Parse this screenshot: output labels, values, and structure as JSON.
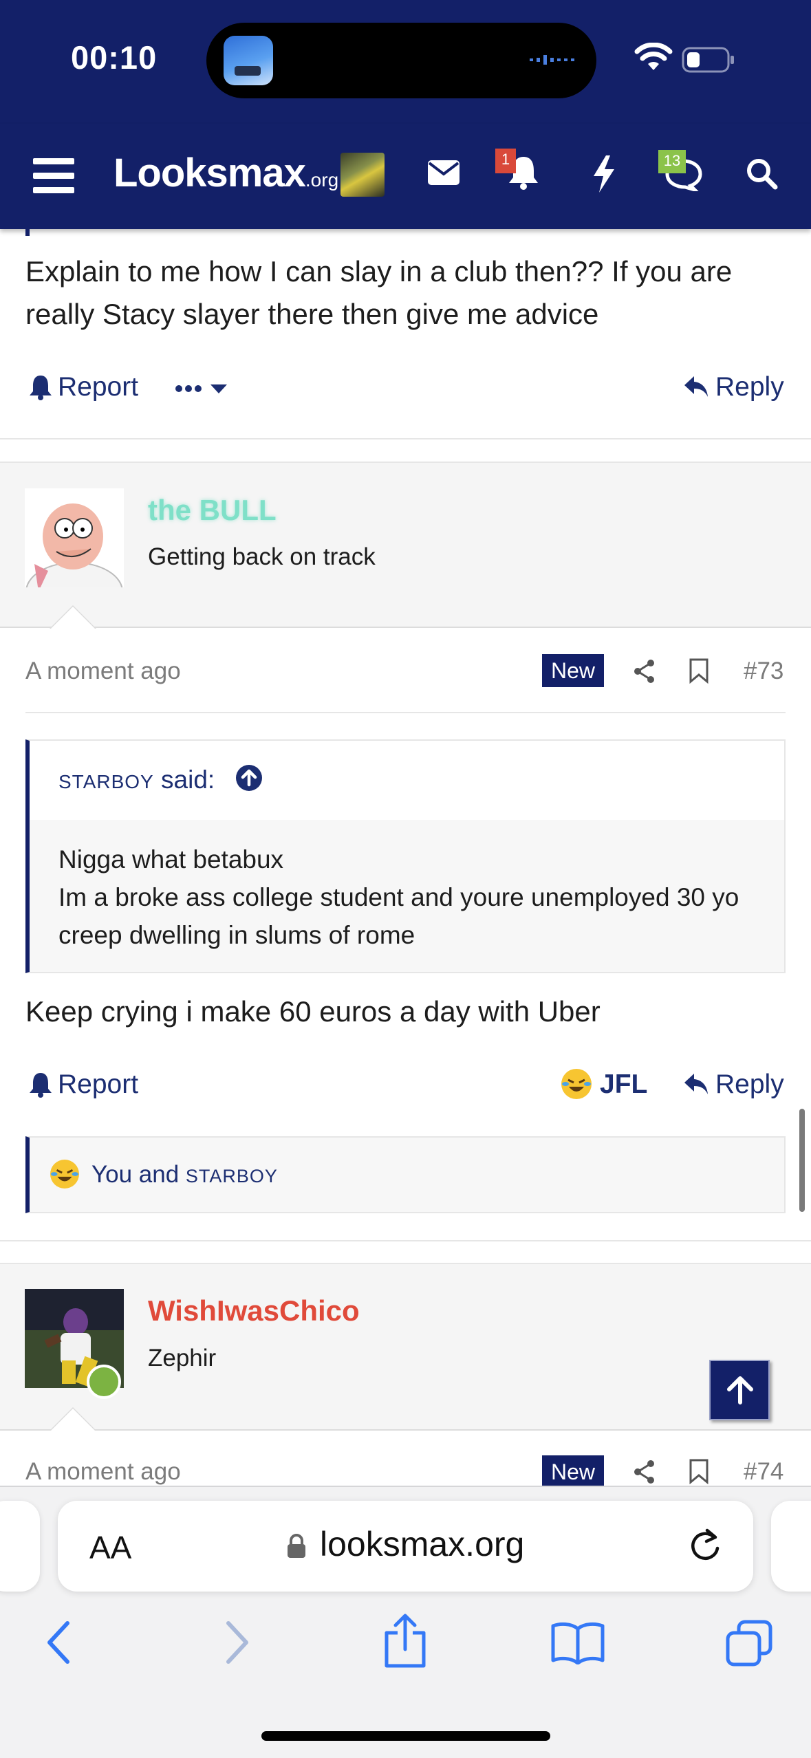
{
  "status": {
    "time": "00:10"
  },
  "nav": {
    "logo_main": "Looksmax",
    "logo_tld": ".org",
    "alerts_count": "1",
    "conversations_count": "13"
  },
  "post72": {
    "text": "Explain to me how I can slay in a club then?? If you are really Stacy slayer there then give me advice",
    "report": "Report",
    "reply": "Reply"
  },
  "post73": {
    "username": "the BULL",
    "username_color": "#7fe0c8",
    "user_title": "Getting back on track",
    "time": "A moment ago",
    "new_label": "New",
    "number": "#73",
    "quote": {
      "author": "STARBOY",
      "said": "said:",
      "lines": [
        "Nigga what betabux",
        "Im a broke ass college student and youre unemployed 30 yo creep dwelling in slums of rome"
      ]
    },
    "text": "Keep crying i make 60 euros a day with Uber",
    "report": "Report",
    "reaction_label": "JFL",
    "reply": "Reply",
    "reactions_you": "You and",
    "reactions_user": "STARBOY"
  },
  "post74": {
    "username": "WishIwasChico",
    "username_color": "#e04a3a",
    "user_title": "Zephir",
    "online_color": "#7cb342",
    "time": "A moment ago",
    "new_label": "New",
    "number": "#74"
  },
  "browser": {
    "text_size_label": "AA",
    "url": "looksmax.org"
  },
  "colors": {
    "nav_bg": "#132068",
    "link": "#1c2e72",
    "badge_red": "#d9493a",
    "badge_green": "#8bc34a"
  }
}
